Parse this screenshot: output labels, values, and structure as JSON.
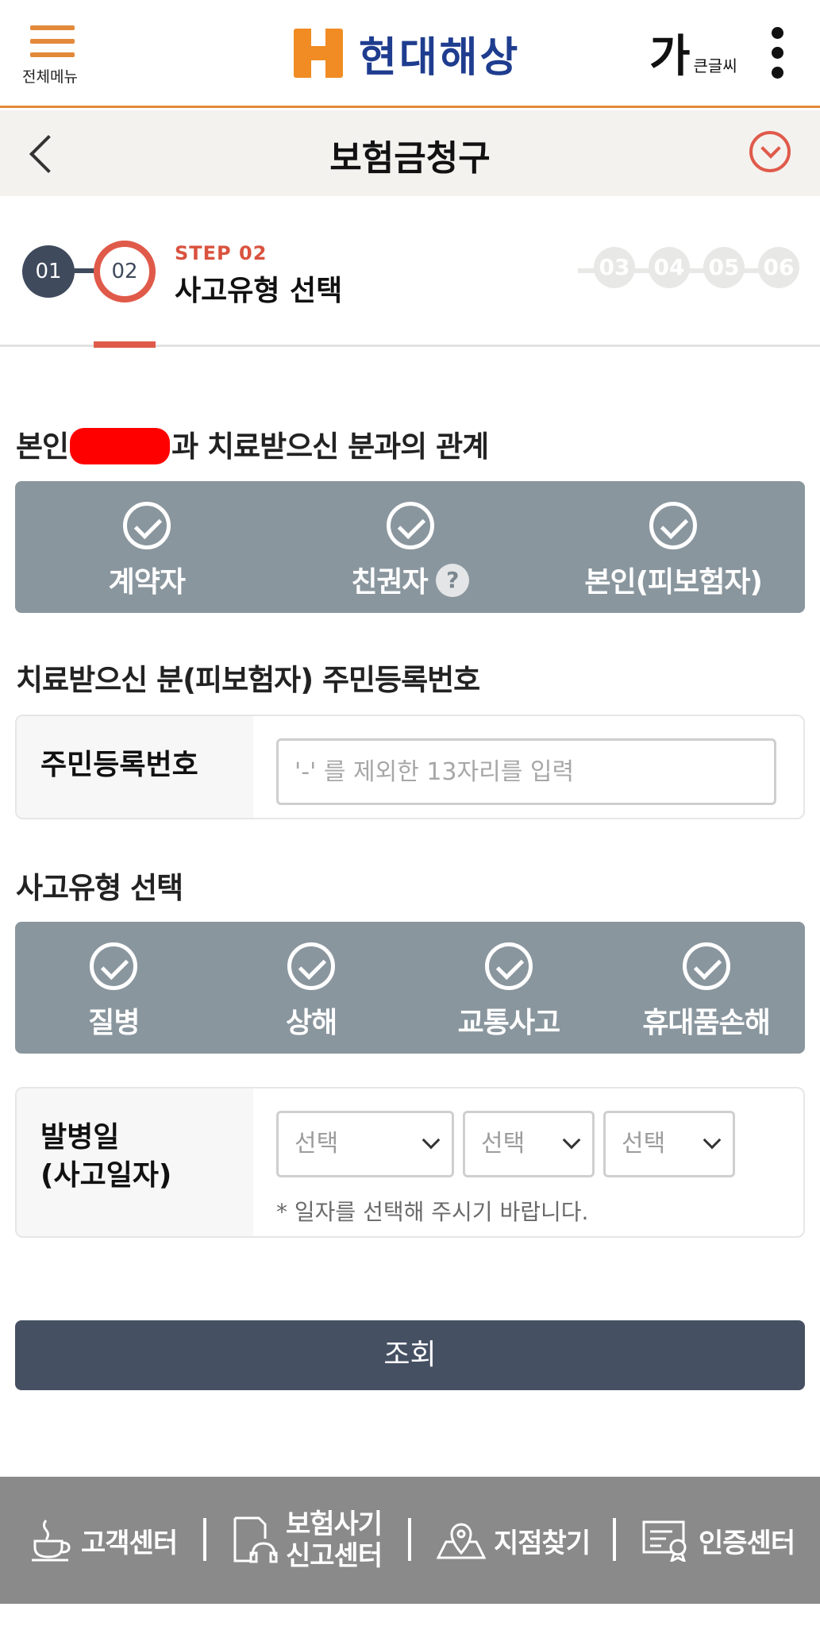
{
  "header": {
    "menu_label": "전체메뉴",
    "brand_name": "현대해상",
    "font_size_big": "가",
    "font_size_small": "큰글씨",
    "accent_color": "#e3893a"
  },
  "titlebar": {
    "title": "보험금청구"
  },
  "stepper": {
    "done_step": "01",
    "current_step": "02",
    "current_tag": "STEP 02",
    "current_name": "사고유형 선택",
    "future_steps": [
      "03",
      "04",
      "05",
      "06"
    ]
  },
  "relation": {
    "label_before": "본인",
    "label_after": "과 치료받으신 분과의 관계",
    "options": [
      "계약자",
      "친권자",
      "본인(피보험자)"
    ],
    "help_glyph": "?"
  },
  "resident_number": {
    "section_label": "치료받으신 분(피보험자) 주민등록번호",
    "field_label": "주민등록번호",
    "value": "",
    "placeholder": "'-' 를 제외한 13자리를 입력"
  },
  "accident_type": {
    "section_label": "사고유형 선택",
    "options": [
      "질병",
      "상해",
      "교통사고",
      "휴대품손해"
    ]
  },
  "accident_date": {
    "label_line1": "발병일",
    "label_line2": "(사고일자)",
    "selects": [
      "선택",
      "선택",
      "선택"
    ],
    "note": "* 일자를 선택해 주시기 바랍니다."
  },
  "search_button": "조회",
  "footer": {
    "items": [
      {
        "label": "고객센터"
      },
      {
        "label_line1": "보험사기",
        "label_line2": "신고센터"
      },
      {
        "label": "지점찾기"
      },
      {
        "label": "인증센터"
      }
    ]
  }
}
